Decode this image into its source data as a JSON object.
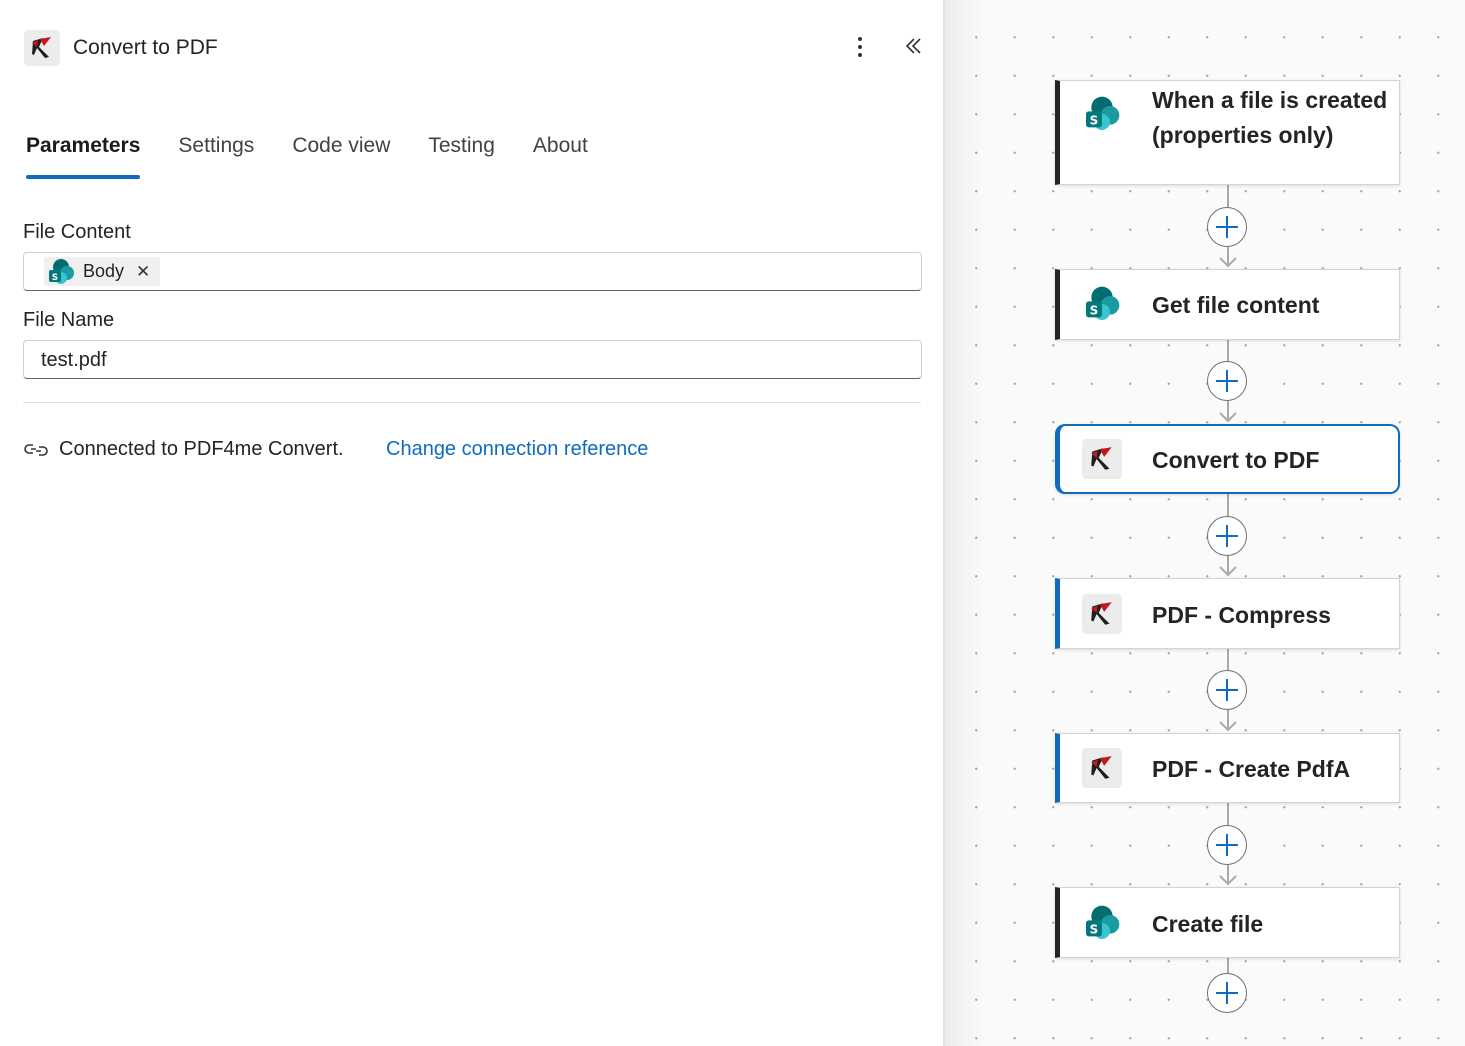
{
  "panel": {
    "title": "Convert to PDF",
    "header_icon": "pdf4me-icon",
    "more_icon": "more-vertical-icon",
    "collapse_icon": "chevron-double-left-icon",
    "tabs": [
      {
        "label": "Parameters",
        "active": true
      },
      {
        "label": "Settings",
        "active": false
      },
      {
        "label": "Code view",
        "active": false
      },
      {
        "label": "Testing",
        "active": false
      },
      {
        "label": "About",
        "active": false
      }
    ],
    "file_content": {
      "label": "File Content",
      "token": {
        "label": "Body",
        "icon": "sharepoint-icon",
        "remove_icon": "close-icon"
      }
    },
    "file_name": {
      "label": "File Name",
      "value": "test.pdf"
    },
    "connection": {
      "icon": "link-icon",
      "text": "Connected to PDF4me Convert.",
      "link": "Change connection reference"
    }
  },
  "flow": {
    "steps": [
      {
        "label": "When a file is created (properties only)",
        "icon": "sharepoint-icon",
        "selected": false
      },
      {
        "label": "Get file content",
        "icon": "sharepoint-icon",
        "selected": false
      },
      {
        "label": "Convert to PDF",
        "icon": "pdf4me-icon",
        "selected": true
      },
      {
        "label": "PDF - Compress",
        "icon": "pdf4me-icon",
        "selected": false
      },
      {
        "label": "PDF - Create PdfA",
        "icon": "pdf4me-icon",
        "selected": false
      },
      {
        "label": "Create file",
        "icon": "sharepoint-icon",
        "selected": false
      }
    ],
    "add_icon": "plus-icon"
  },
  "colors": {
    "accent": "#0f6cbd",
    "text": "#242424",
    "pdf4me_red": "#c4161c",
    "sharepoint_teal": "#03787c"
  }
}
